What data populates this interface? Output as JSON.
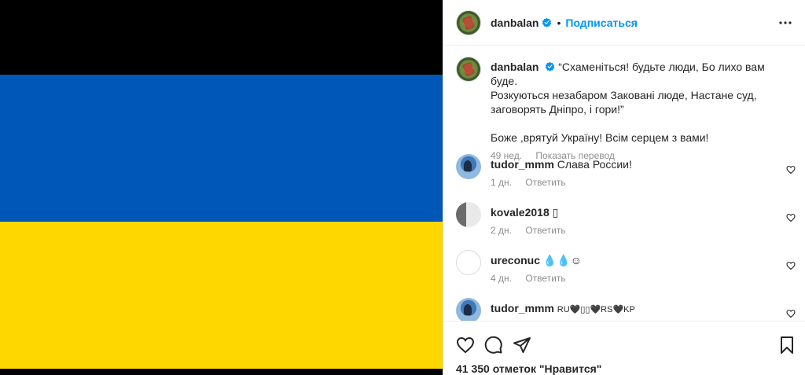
{
  "post": {
    "author": "danbalan",
    "follow_label": "Подписаться",
    "dot": "•"
  },
  "caption": {
    "author": "danbalan",
    "text_line1": "“Схаменіться! будьте люди, Бо лихо вам буде.",
    "text_line2": "Розкуються незабаром Заковані люде, Настане суд,",
    "text_line3": "заговорять Дніпро, і гори!”",
    "text_line4": "Боже ,врятуй Україну! Всім серцем з вами!",
    "time": "49 нед.",
    "translate_label": "Показать перевод"
  },
  "comments": [
    {
      "user": "tudor_mmm",
      "text": "Слава России!",
      "time": "1 дн.",
      "reply": "Ответить"
    },
    {
      "user": "kovale2018",
      "text": "▯",
      "time": "2 дн.",
      "reply": "Ответить"
    },
    {
      "user": "ureconuc",
      "text": "💧💧☺",
      "time": "4 дн.",
      "reply": "Ответить"
    },
    {
      "user": "tudor_mmm",
      "text": "RU🖤▯▯🖤RS🖤KP",
      "time": "",
      "reply": ""
    }
  ],
  "likes": "41 350 отметок \"Нравится\"",
  "colors": {
    "flag_blue": "#0057B8",
    "flag_yellow": "#FFD700",
    "link": "#0095f6",
    "verified": "#0095f6"
  }
}
